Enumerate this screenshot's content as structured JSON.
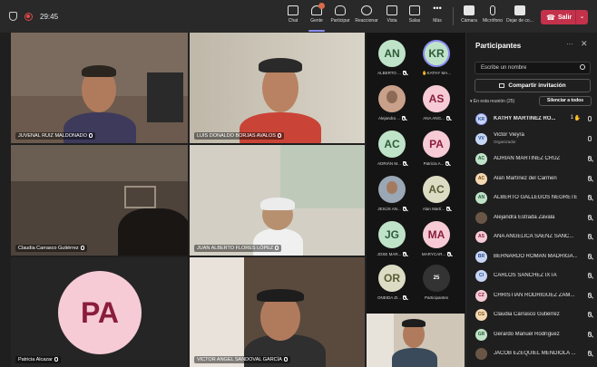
{
  "topbar": {
    "timer": "29:45",
    "items": [
      {
        "label": "Chat",
        "icon": "chat-icon"
      },
      {
        "label": "Gente",
        "icon": "people-icon",
        "active": true
      },
      {
        "label": "Participar",
        "icon": "raise-hand-icon"
      },
      {
        "label": "Reaccionar",
        "icon": "smiley-icon"
      },
      {
        "label": "Vista",
        "icon": "grid-view-icon"
      },
      {
        "label": "Salas",
        "icon": "breakout-rooms-icon"
      },
      {
        "label": "Más",
        "icon": "more-icon"
      },
      {
        "label": "Cámara",
        "icon": "camera-icon"
      },
      {
        "label": "Micrófono",
        "icon": "microphone-icon"
      },
      {
        "label": "Dejar de co...",
        "icon": "stop-share-icon"
      }
    ],
    "leave_label": "Salir"
  },
  "tiles": [
    {
      "name": "JUVENAL RUIZ MALDONADO"
    },
    {
      "name": "LUIS DONALDO BORJAS AVALOS"
    },
    {
      "name": "Claudia Carrasco Gutiérrez"
    },
    {
      "name": "JUAN ALBERTO FLORES LÓPEZ"
    },
    {
      "name": "Patricia Alcazar",
      "initials": "PA"
    },
    {
      "name": "VICTOR ANGEL SANDOVAL GARCÍA"
    }
  ],
  "gallery": [
    {
      "initials": "AN",
      "label": "ALBERTO ..."
    },
    {
      "initials": "KR",
      "label": "KATHY MA..."
    },
    {
      "initials": "",
      "label": "Alejandra ..."
    },
    {
      "initials": "AS",
      "label": "ANA ANG..."
    },
    {
      "initials": "AC",
      "label": "ADRIÁN M..."
    },
    {
      "initials": "PA",
      "label": "Patricia A..."
    },
    {
      "initials": "",
      "label": "JESÚS AN..."
    },
    {
      "initials": "AC",
      "label": "Alan Martí..."
    },
    {
      "initials": "JG",
      "label": "JOSE MAR..."
    },
    {
      "initials": "MA",
      "label": "MARYCAR..."
    },
    {
      "initials": "OR",
      "label": "ONEIDA ZI..."
    },
    {
      "initials": "25",
      "label": "Participantes"
    }
  ],
  "panel": {
    "title": "Participantes",
    "search_placeholder": "Escribe un nombre",
    "share_label": "Compartir invitación",
    "section_label": "En esta reunión (25)",
    "mute_all_label": "Silenciar a todos",
    "participants": [
      {
        "initials": "KR",
        "name": "KATHY MARTINEZ RO...",
        "hand_count": "1",
        "color": "b"
      },
      {
        "initials": "VV",
        "name": "Victor Vieyra",
        "sub": "Organizador",
        "color": "b"
      },
      {
        "initials": "AC",
        "name": "ADRIÁN MARTÍNEZ CRUZ",
        "color": "g"
      },
      {
        "initials": "AC",
        "name": "Alan Martínez del Carmen",
        "color": "o"
      },
      {
        "initials": "AN",
        "name": "ALBERTO GALLEGOS NEGRETE",
        "color": "g"
      },
      {
        "initials": "",
        "name": "Alejandra Estrada Zavala",
        "color": "photo"
      },
      {
        "initials": "AS",
        "name": "ANA ANGÉLICA SÁENZ SÁNC...",
        "color": "p"
      },
      {
        "initials": "BR",
        "name": "BERNARDO ROMÁN MADRIGA...",
        "color": "b"
      },
      {
        "initials": "CI",
        "name": "CARLOS SANCHEZ IXTA",
        "color": "b"
      },
      {
        "initials": "CZ",
        "name": "CHRISTIAN RODRIGUEZ ZAM...",
        "color": "p"
      },
      {
        "initials": "CG",
        "name": "Claudia Carrasco Gutiérrez",
        "color": "o"
      },
      {
        "initials": "GR",
        "name": "Gerardo Manuel Rodríguez",
        "color": "g"
      },
      {
        "initials": "",
        "name": "JACOB EZEQUIEL MENDIOLA ...",
        "color": "photo"
      }
    ]
  }
}
